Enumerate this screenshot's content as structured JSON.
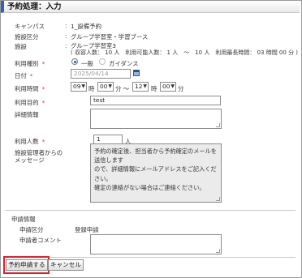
{
  "page_title": "予約処理：入力",
  "fields": {
    "campus": {
      "label": "キャンパス",
      "value": "1_設備予約"
    },
    "facility_type": {
      "label": "施設区分",
      "value": "グループ学習室・学習ブース"
    },
    "facility": {
      "label": "施設",
      "value_line1": "グループ学習室3",
      "value_line2": "( 収容人数： 10 人　利用可能人数： 1 人　～　10 人　利用最長時間： 03 時間 00 分 )"
    },
    "usage_type": {
      "label": "利用種別",
      "required_mark": "*",
      "options": [
        "一般",
        "ガイダンス"
      ],
      "selected": "一般"
    },
    "date": {
      "label": "日付",
      "required_mark": "*",
      "value": "2025/04/14"
    },
    "time": {
      "label": "利用時間",
      "required_mark": "*",
      "start_hour": "09",
      "hour_unit": "時",
      "start_min": "00",
      "min_unit": "分 ～",
      "end_hour": "12",
      "end_hour_unit": "時",
      "end_min": "00",
      "end_min_unit": "分"
    },
    "purpose": {
      "label": "利用目的",
      "required_mark": "*",
      "value": "test"
    },
    "details": {
      "label": "詳細情報",
      "value": ""
    },
    "people": {
      "label": "利用人数",
      "required_mark": "*",
      "value": "1",
      "unit": "人"
    },
    "admin_message": {
      "label_line1": "施設管理者からの",
      "label_line2": "メッセージ",
      "lines": [
        "予約の確定後、担当者から予約確定のメールを送信します",
        "ので、詳細情報にメールアドレスをご記入ください。",
        "確定の連絡がない場合はご連絡ください。"
      ]
    }
  },
  "application": {
    "section_label": "申請情報",
    "type_label": "申請区分",
    "type_value": "登録申請",
    "comment_label": "申請者コメント",
    "comment_value": ""
  },
  "buttons": {
    "submit": "予約申請する",
    "cancel": "キャンセル"
  },
  "colors": {
    "accent": "#2e64b8",
    "required": "#dd3333",
    "highlight": "#e01f2b"
  }
}
